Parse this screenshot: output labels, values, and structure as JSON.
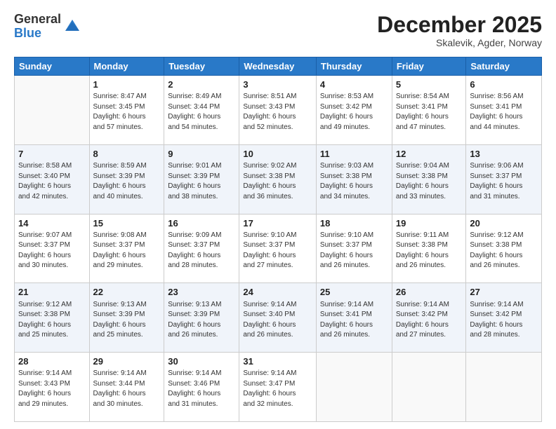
{
  "logo": {
    "general": "General",
    "blue": "Blue"
  },
  "header": {
    "month": "December 2025",
    "location": "Skalevik, Agder, Norway"
  },
  "weekdays": [
    "Sunday",
    "Monday",
    "Tuesday",
    "Wednesday",
    "Thursday",
    "Friday",
    "Saturday"
  ],
  "weeks": [
    [
      {
        "day": "",
        "info": ""
      },
      {
        "day": "1",
        "info": "Sunrise: 8:47 AM\nSunset: 3:45 PM\nDaylight: 6 hours\nand 57 minutes."
      },
      {
        "day": "2",
        "info": "Sunrise: 8:49 AM\nSunset: 3:44 PM\nDaylight: 6 hours\nand 54 minutes."
      },
      {
        "day": "3",
        "info": "Sunrise: 8:51 AM\nSunset: 3:43 PM\nDaylight: 6 hours\nand 52 minutes."
      },
      {
        "day": "4",
        "info": "Sunrise: 8:53 AM\nSunset: 3:42 PM\nDaylight: 6 hours\nand 49 minutes."
      },
      {
        "day": "5",
        "info": "Sunrise: 8:54 AM\nSunset: 3:41 PM\nDaylight: 6 hours\nand 47 minutes."
      },
      {
        "day": "6",
        "info": "Sunrise: 8:56 AM\nSunset: 3:41 PM\nDaylight: 6 hours\nand 44 minutes."
      }
    ],
    [
      {
        "day": "7",
        "info": "Sunrise: 8:58 AM\nSunset: 3:40 PM\nDaylight: 6 hours\nand 42 minutes."
      },
      {
        "day": "8",
        "info": "Sunrise: 8:59 AM\nSunset: 3:39 PM\nDaylight: 6 hours\nand 40 minutes."
      },
      {
        "day": "9",
        "info": "Sunrise: 9:01 AM\nSunset: 3:39 PM\nDaylight: 6 hours\nand 38 minutes."
      },
      {
        "day": "10",
        "info": "Sunrise: 9:02 AM\nSunset: 3:38 PM\nDaylight: 6 hours\nand 36 minutes."
      },
      {
        "day": "11",
        "info": "Sunrise: 9:03 AM\nSunset: 3:38 PM\nDaylight: 6 hours\nand 34 minutes."
      },
      {
        "day": "12",
        "info": "Sunrise: 9:04 AM\nSunset: 3:38 PM\nDaylight: 6 hours\nand 33 minutes."
      },
      {
        "day": "13",
        "info": "Sunrise: 9:06 AM\nSunset: 3:37 PM\nDaylight: 6 hours\nand 31 minutes."
      }
    ],
    [
      {
        "day": "14",
        "info": "Sunrise: 9:07 AM\nSunset: 3:37 PM\nDaylight: 6 hours\nand 30 minutes."
      },
      {
        "day": "15",
        "info": "Sunrise: 9:08 AM\nSunset: 3:37 PM\nDaylight: 6 hours\nand 29 minutes."
      },
      {
        "day": "16",
        "info": "Sunrise: 9:09 AM\nSunset: 3:37 PM\nDaylight: 6 hours\nand 28 minutes."
      },
      {
        "day": "17",
        "info": "Sunrise: 9:10 AM\nSunset: 3:37 PM\nDaylight: 6 hours\nand 27 minutes."
      },
      {
        "day": "18",
        "info": "Sunrise: 9:10 AM\nSunset: 3:37 PM\nDaylight: 6 hours\nand 26 minutes."
      },
      {
        "day": "19",
        "info": "Sunrise: 9:11 AM\nSunset: 3:38 PM\nDaylight: 6 hours\nand 26 minutes."
      },
      {
        "day": "20",
        "info": "Sunrise: 9:12 AM\nSunset: 3:38 PM\nDaylight: 6 hours\nand 26 minutes."
      }
    ],
    [
      {
        "day": "21",
        "info": "Sunrise: 9:12 AM\nSunset: 3:38 PM\nDaylight: 6 hours\nand 25 minutes."
      },
      {
        "day": "22",
        "info": "Sunrise: 9:13 AM\nSunset: 3:39 PM\nDaylight: 6 hours\nand 25 minutes."
      },
      {
        "day": "23",
        "info": "Sunrise: 9:13 AM\nSunset: 3:39 PM\nDaylight: 6 hours\nand 26 minutes."
      },
      {
        "day": "24",
        "info": "Sunrise: 9:14 AM\nSunset: 3:40 PM\nDaylight: 6 hours\nand 26 minutes."
      },
      {
        "day": "25",
        "info": "Sunrise: 9:14 AM\nSunset: 3:41 PM\nDaylight: 6 hours\nand 26 minutes."
      },
      {
        "day": "26",
        "info": "Sunrise: 9:14 AM\nSunset: 3:42 PM\nDaylight: 6 hours\nand 27 minutes."
      },
      {
        "day": "27",
        "info": "Sunrise: 9:14 AM\nSunset: 3:42 PM\nDaylight: 6 hours\nand 28 minutes."
      }
    ],
    [
      {
        "day": "28",
        "info": "Sunrise: 9:14 AM\nSunset: 3:43 PM\nDaylight: 6 hours\nand 29 minutes."
      },
      {
        "day": "29",
        "info": "Sunrise: 9:14 AM\nSunset: 3:44 PM\nDaylight: 6 hours\nand 30 minutes."
      },
      {
        "day": "30",
        "info": "Sunrise: 9:14 AM\nSunset: 3:46 PM\nDaylight: 6 hours\nand 31 minutes."
      },
      {
        "day": "31",
        "info": "Sunrise: 9:14 AM\nSunset: 3:47 PM\nDaylight: 6 hours\nand 32 minutes."
      },
      {
        "day": "",
        "info": ""
      },
      {
        "day": "",
        "info": ""
      },
      {
        "day": "",
        "info": ""
      }
    ]
  ]
}
